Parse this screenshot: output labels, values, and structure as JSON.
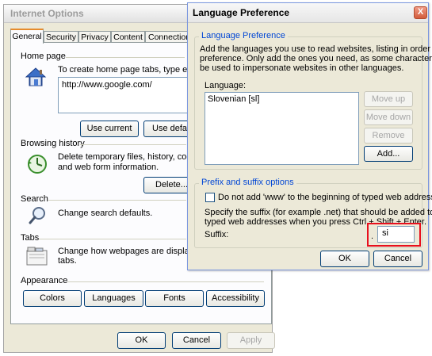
{
  "internet_options": {
    "title": "Internet Options",
    "tabs": [
      "General",
      "Security",
      "Privacy",
      "Content",
      "Connections"
    ],
    "home_page": {
      "label": "Home page",
      "description": "To create home page tabs, type each address",
      "url": "http://www.google.com/",
      "use_current": "Use current",
      "use_default": "Use default"
    },
    "browsing_history": {
      "label": "Browsing history",
      "description_line1": "Delete temporary files, history, cookies,",
      "description_line2": "and web form information.",
      "delete": "Delete..."
    },
    "search": {
      "label": "Search",
      "description": "Change search defaults."
    },
    "tabs_section": {
      "label": "Tabs",
      "description_line1": "Change how webpages are displayed in",
      "description_line2": "tabs."
    },
    "appearance": {
      "label": "Appearance",
      "buttons": [
        "Colors",
        "Languages",
        "Fonts",
        "Accessibility"
      ]
    },
    "footer": {
      "ok": "OK",
      "cancel": "Cancel",
      "apply": "Apply"
    }
  },
  "language_preference": {
    "title": "Language Preference",
    "close": "X",
    "group1": {
      "label": "Language Preference",
      "desc_line1": "Add the languages you use to read websites, listing in order of",
      "desc_line2": "preference. Only add the ones you need, as some characters can",
      "desc_line3": "be used to impersonate websites in other languages.",
      "list_label": "Language:",
      "languages": [
        "Slovenian [sl]"
      ],
      "move_up": "Move up",
      "move_down": "Move down",
      "remove": "Remove",
      "add": "Add..."
    },
    "group2": {
      "label": "Prefix and suffix options",
      "checkbox_label": "Do not add 'www' to the beginning of typed web addresses",
      "desc_line1": "Specify the suffix (for example .net) that should be added to",
      "desc_line2": "typed web addresses when you press Ctrl + Shift + Enter.",
      "suffix_label": "Suffix:",
      "suffix_dot": ".",
      "suffix_value": "si"
    },
    "ok": "OK",
    "cancel": "Cancel"
  },
  "colors": {
    "group_label_blue": "#0046d5",
    "highlight_red": "#e8101d",
    "xp_button_border": "#003c74"
  }
}
